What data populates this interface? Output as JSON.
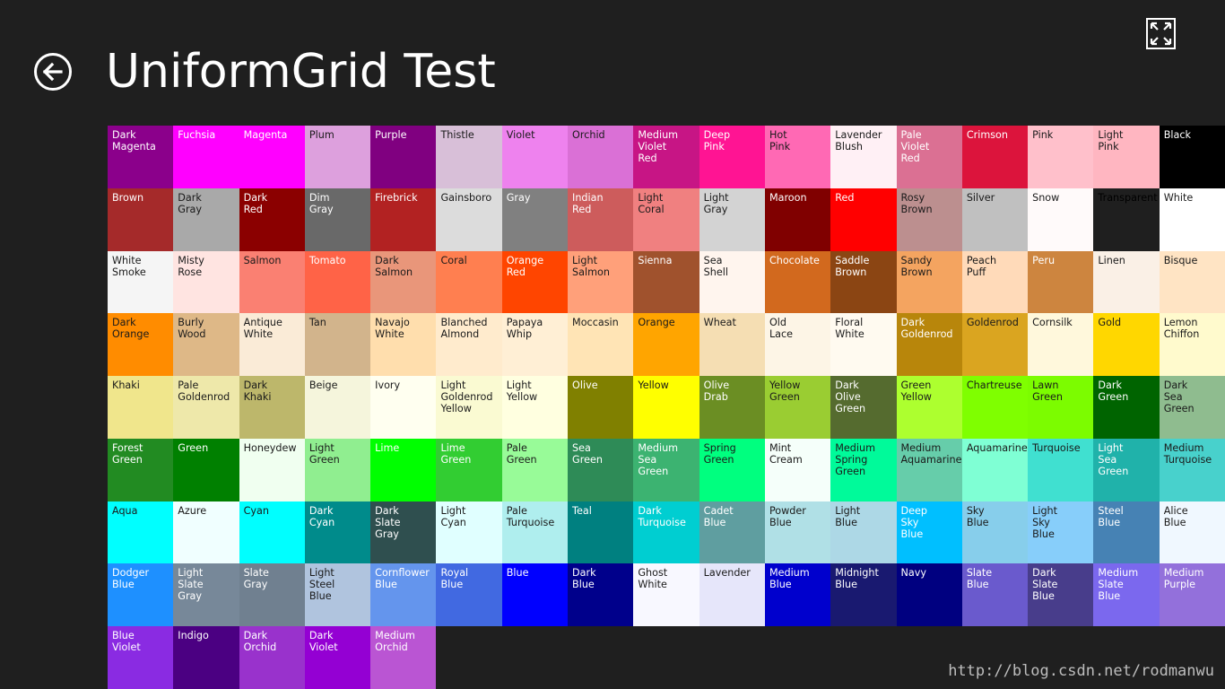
{
  "page": {
    "title": "UniformGrid Test",
    "back_icon": "back-arrow-circle-icon",
    "fullscreen_icon": "fullscreen-expand-icon",
    "watermark": "http://blog.csdn.net/rodmanwu"
  },
  "colors": {
    "background": "#1f1f1f",
    "foreground": "#ffffff"
  },
  "grid": [
    {
      "name": "Dark\nMagenta",
      "hex": "#8B008B"
    },
    {
      "name": "Fuchsia",
      "hex": "#FF00FF"
    },
    {
      "name": "Magenta",
      "hex": "#FF00FF"
    },
    {
      "name": "Plum",
      "hex": "#DDA0DD"
    },
    {
      "name": "Purple",
      "hex": "#800080"
    },
    {
      "name": "Thistle",
      "hex": "#D8BFD8"
    },
    {
      "name": "Violet",
      "hex": "#EE82EE"
    },
    {
      "name": "Orchid",
      "hex": "#DA70D6"
    },
    {
      "name": "Medium\nViolet\nRed",
      "hex": "#C71585"
    },
    {
      "name": "Deep\nPink",
      "hex": "#FF1493"
    },
    {
      "name": "Hot\nPink",
      "hex": "#FF69B4"
    },
    {
      "name": "Lavender\nBlush",
      "hex": "#FFF0F5"
    },
    {
      "name": "Pale\nViolet\nRed",
      "hex": "#DB7093"
    },
    {
      "name": "Crimson",
      "hex": "#DC143C"
    },
    {
      "name": "Pink",
      "hex": "#FFC0CB"
    },
    {
      "name": "Light\nPink",
      "hex": "#FFB6C1"
    },
    {
      "name": "Black",
      "hex": "#000000"
    },
    {
      "name": "Brown",
      "hex": "#A52A2A"
    },
    {
      "name": "Dark\nGray",
      "hex": "#A9A9A9"
    },
    {
      "name": "Dark\nRed",
      "hex": "#8B0000"
    },
    {
      "name": "Dim\nGray",
      "hex": "#696969"
    },
    {
      "name": "Firebrick",
      "hex": "#B22222"
    },
    {
      "name": "Gainsboro",
      "hex": "#DCDCDC"
    },
    {
      "name": "Gray",
      "hex": "#808080"
    },
    {
      "name": "Indian\nRed",
      "hex": "#CD5C5C"
    },
    {
      "name": "Light\nCoral",
      "hex": "#F08080"
    },
    {
      "name": "Light\nGray",
      "hex": "#D3D3D3"
    },
    {
      "name": "Maroon",
      "hex": "#800000"
    },
    {
      "name": "Red",
      "hex": "#FF0000"
    },
    {
      "name": "Rosy\nBrown",
      "hex": "#BC8F8F"
    },
    {
      "name": "Silver",
      "hex": "#C0C0C0"
    },
    {
      "name": "Snow",
      "hex": "#FFFAFA"
    },
    {
      "name": "Transparent",
      "hex": "#1f1f1f"
    },
    {
      "name": "White",
      "hex": "#FFFFFF"
    },
    {
      "name": "White\nSmoke",
      "hex": "#F5F5F5"
    },
    {
      "name": "Misty\nRose",
      "hex": "#FFE4E1"
    },
    {
      "name": "Salmon",
      "hex": "#FA8072"
    },
    {
      "name": "Tomato",
      "hex": "#FF6347"
    },
    {
      "name": "Dark\nSalmon",
      "hex": "#E9967A"
    },
    {
      "name": "Coral",
      "hex": "#FF7F50"
    },
    {
      "name": "Orange\nRed",
      "hex": "#FF4500"
    },
    {
      "name": "Light\nSalmon",
      "hex": "#FFA07A"
    },
    {
      "name": "Sienna",
      "hex": "#A0522D"
    },
    {
      "name": "Sea\nShell",
      "hex": "#FFF5EE"
    },
    {
      "name": "Chocolate",
      "hex": "#D2691E"
    },
    {
      "name": "Saddle\nBrown",
      "hex": "#8B4513"
    },
    {
      "name": "Sandy\nBrown",
      "hex": "#F4A460"
    },
    {
      "name": "Peach\nPuff",
      "hex": "#FFDAB9"
    },
    {
      "name": "Peru",
      "hex": "#CD853F"
    },
    {
      "name": "Linen",
      "hex": "#FAF0E6"
    },
    {
      "name": "Bisque",
      "hex": "#FFE4C4"
    },
    {
      "name": "Dark\nOrange",
      "hex": "#FF8C00"
    },
    {
      "name": "Burly\nWood",
      "hex": "#DEB887"
    },
    {
      "name": "Antique\nWhite",
      "hex": "#FAEBD7"
    },
    {
      "name": "Tan",
      "hex": "#D2B48C"
    },
    {
      "name": "Navajo\nWhite",
      "hex": "#FFDEAD"
    },
    {
      "name": "Blanched\nAlmond",
      "hex": "#FFEBCD"
    },
    {
      "name": "Papaya\nWhip",
      "hex": "#FFEFD5"
    },
    {
      "name": "Moccasin",
      "hex": "#FFE4B5"
    },
    {
      "name": "Orange",
      "hex": "#FFA500"
    },
    {
      "name": "Wheat",
      "hex": "#F5DEB3"
    },
    {
      "name": "Old\nLace",
      "hex": "#FDF5E6"
    },
    {
      "name": "Floral\nWhite",
      "hex": "#FFFAF0"
    },
    {
      "name": "Dark\nGoldenrod",
      "hex": "#B8860B"
    },
    {
      "name": "Goldenrod",
      "hex": "#DAA520"
    },
    {
      "name": "Cornsilk",
      "hex": "#FFF8DC"
    },
    {
      "name": "Gold",
      "hex": "#FFD700"
    },
    {
      "name": "Lemon\nChiffon",
      "hex": "#FFFACD"
    },
    {
      "name": "Khaki",
      "hex": "#F0E68C"
    },
    {
      "name": "Pale\nGoldenrod",
      "hex": "#EEE8AA"
    },
    {
      "name": "Dark\nKhaki",
      "hex": "#BDB76B"
    },
    {
      "name": "Beige",
      "hex": "#F5F5DC"
    },
    {
      "name": "Ivory",
      "hex": "#FFFFF0"
    },
    {
      "name": "Light\nGoldenrod\nYellow",
      "hex": "#FAFAD2"
    },
    {
      "name": "Light\nYellow",
      "hex": "#FFFFE0"
    },
    {
      "name": "Olive",
      "hex": "#808000"
    },
    {
      "name": "Yellow",
      "hex": "#FFFF00"
    },
    {
      "name": "Olive\nDrab",
      "hex": "#6B8E23"
    },
    {
      "name": "Yellow\nGreen",
      "hex": "#9ACD32"
    },
    {
      "name": "Dark\nOlive\nGreen",
      "hex": "#556B2F"
    },
    {
      "name": "Green\nYellow",
      "hex": "#ADFF2F"
    },
    {
      "name": "Chartreuse",
      "hex": "#7FFF00"
    },
    {
      "name": "Lawn\nGreen",
      "hex": "#7CFC00"
    },
    {
      "name": "Dark\nGreen",
      "hex": "#006400"
    },
    {
      "name": "Dark\nSea\nGreen",
      "hex": "#8FBC8F"
    },
    {
      "name": "Forest\nGreen",
      "hex": "#228B22"
    },
    {
      "name": "Green",
      "hex": "#008000"
    },
    {
      "name": "Honeydew",
      "hex": "#F0FFF0"
    },
    {
      "name": "Light\nGreen",
      "hex": "#90EE90"
    },
    {
      "name": "Lime",
      "hex": "#00FF00"
    },
    {
      "name": "Lime\nGreen",
      "hex": "#32CD32"
    },
    {
      "name": "Pale\nGreen",
      "hex": "#98FB98"
    },
    {
      "name": "Sea\nGreen",
      "hex": "#2E8B57"
    },
    {
      "name": "Medium\nSea\nGreen",
      "hex": "#3CB371"
    },
    {
      "name": "Spring\nGreen",
      "hex": "#00FF7F"
    },
    {
      "name": "Mint\nCream",
      "hex": "#F5FFFA"
    },
    {
      "name": "Medium\nSpring\nGreen",
      "hex": "#00FA9A"
    },
    {
      "name": "Medium\nAquamarine",
      "hex": "#66CDAA"
    },
    {
      "name": "Aquamarine",
      "hex": "#7FFFD4"
    },
    {
      "name": "Turquoise",
      "hex": "#40E0D0"
    },
    {
      "name": "Light\nSea\nGreen",
      "hex": "#20B2AA"
    },
    {
      "name": "Medium\nTurquoise",
      "hex": "#48D1CC"
    },
    {
      "name": "Aqua",
      "hex": "#00FFFF"
    },
    {
      "name": "Azure",
      "hex": "#F0FFFF"
    },
    {
      "name": "Cyan",
      "hex": "#00FFFF"
    },
    {
      "name": "Dark\nCyan",
      "hex": "#008B8B"
    },
    {
      "name": "Dark\nSlate\nGray",
      "hex": "#2F4F4F"
    },
    {
      "name": "Light\nCyan",
      "hex": "#E0FFFF"
    },
    {
      "name": "Pale\nTurquoise",
      "hex": "#AFEEEE"
    },
    {
      "name": "Teal",
      "hex": "#008080"
    },
    {
      "name": "Dark\nTurquoise",
      "hex": "#00CED1"
    },
    {
      "name": "Cadet\nBlue",
      "hex": "#5F9EA0"
    },
    {
      "name": "Powder\nBlue",
      "hex": "#B0E0E6"
    },
    {
      "name": "Light\nBlue",
      "hex": "#ADD8E6"
    },
    {
      "name": "Deep\nSky\nBlue",
      "hex": "#00BFFF"
    },
    {
      "name": "Sky\nBlue",
      "hex": "#87CEEB"
    },
    {
      "name": "Light\nSky\nBlue",
      "hex": "#87CEFA"
    },
    {
      "name": "Steel\nBlue",
      "hex": "#4682B4"
    },
    {
      "name": "Alice\nBlue",
      "hex": "#F0F8FF"
    },
    {
      "name": "Dodger\nBlue",
      "hex": "#1E90FF"
    },
    {
      "name": "Light\nSlate\nGray",
      "hex": "#778899"
    },
    {
      "name": "Slate\nGray",
      "hex": "#708090"
    },
    {
      "name": "Light\nSteel\nBlue",
      "hex": "#B0C4DE"
    },
    {
      "name": "Cornflower\nBlue",
      "hex": "#6495ED"
    },
    {
      "name": "Royal\nBlue",
      "hex": "#4169E1"
    },
    {
      "name": "Blue",
      "hex": "#0000FF"
    },
    {
      "name": "Dark\nBlue",
      "hex": "#00008B"
    },
    {
      "name": "Ghost\nWhite",
      "hex": "#F8F8FF"
    },
    {
      "name": "Lavender",
      "hex": "#E6E6FA"
    },
    {
      "name": "Medium\nBlue",
      "hex": "#0000CD"
    },
    {
      "name": "Midnight\nBlue",
      "hex": "#191970"
    },
    {
      "name": "Navy",
      "hex": "#000080"
    },
    {
      "name": "Slate\nBlue",
      "hex": "#6A5ACD"
    },
    {
      "name": "Dark\nSlate\nBlue",
      "hex": "#483D8B"
    },
    {
      "name": "Medium\nSlate\nBlue",
      "hex": "#7B68EE"
    },
    {
      "name": "Medium\nPurple",
      "hex": "#9370DB"
    },
    {
      "name": "Blue\nViolet",
      "hex": "#8A2BE2"
    },
    {
      "name": "Indigo",
      "hex": "#4B0082"
    },
    {
      "name": "Dark\nOrchid",
      "hex": "#9932CC"
    },
    {
      "name": "Dark\nViolet",
      "hex": "#9400D3"
    },
    {
      "name": "Medium\nOrchid",
      "hex": "#BA55D3"
    }
  ]
}
